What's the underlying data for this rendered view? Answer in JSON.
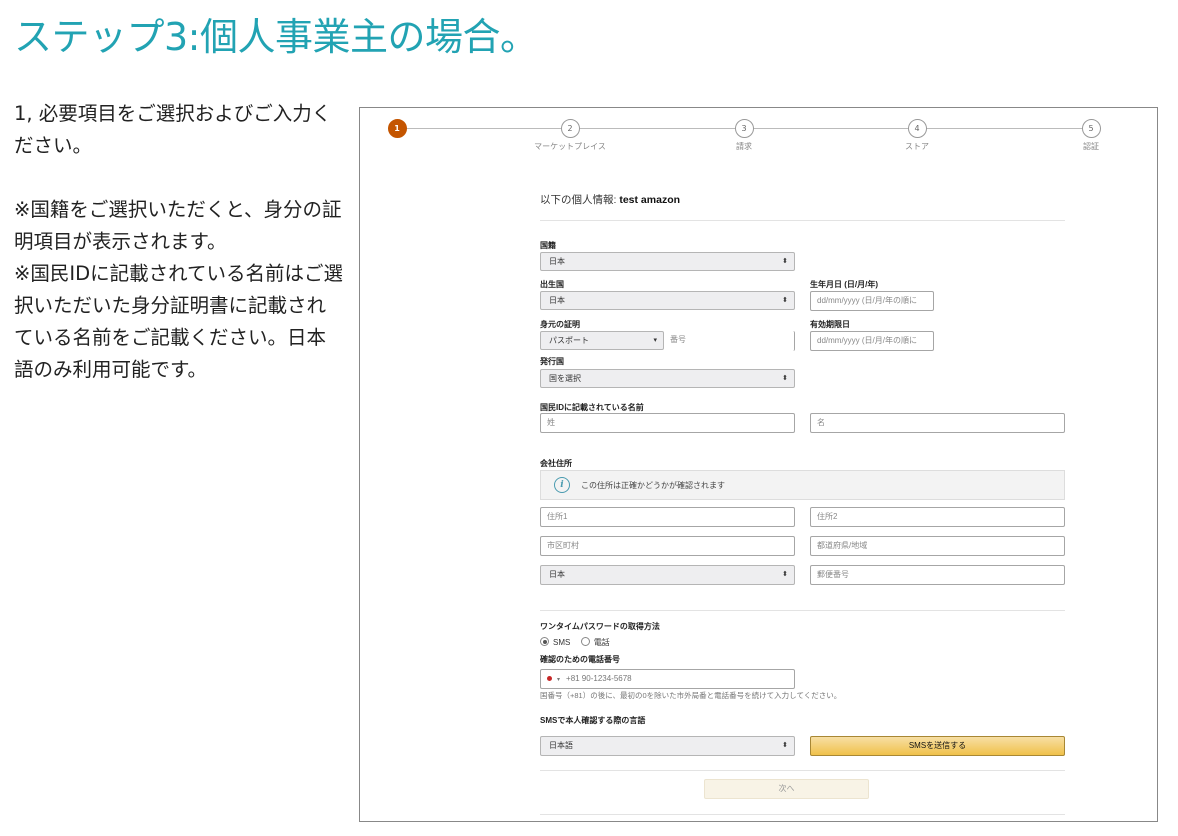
{
  "page_title": "ステップ3:個人事業主の場合。",
  "instructions": {
    "line1": "1, 必要項目をご選択およびご入力ください。",
    "note1": "※国籍をご選択いただくと、身分の証明項目が表示されます。",
    "note2": "※国民IDに記載されている名前はご選択いただいた身分証明書に記載されている名前をご記載ください。日本語のみ利用可能です。"
  },
  "stepper": [
    {
      "number": "1",
      "label": "",
      "active": true
    },
    {
      "number": "2",
      "label": "マーケットプレイス",
      "active": false
    },
    {
      "number": "3",
      "label": "請求",
      "active": false
    },
    {
      "number": "4",
      "label": "ストア",
      "active": false
    },
    {
      "number": "5",
      "label": "認証",
      "active": false
    }
  ],
  "form": {
    "header_prefix": "以下の個人情報: ",
    "header_name": "test amazon",
    "nationality": {
      "label": "国籍",
      "value": "日本"
    },
    "birth_country": {
      "label": "出生国",
      "value": "日本"
    },
    "birth_date": {
      "label": "生年月日 (日/月/年)",
      "placeholder": "dd/mm/yyyy (日/月/年の順に"
    },
    "id_proof": {
      "label": "身元の証明",
      "value": "パスポート",
      "number_placeholder": "番号"
    },
    "expiry": {
      "label": "有効期限日",
      "placeholder": "dd/mm/yyyy (日/月/年の順に"
    },
    "issuing_country": {
      "label": "発行国",
      "value": "国を選択"
    },
    "name_on_id": {
      "label": "国民IDに記載されている名前",
      "last_placeholder": "姓",
      "first_placeholder": "名"
    },
    "company_address": {
      "label": "会社住所",
      "info": "この住所は正確かどうかが確認されます",
      "address1_placeholder": "住所1",
      "address2_placeholder": "住所2",
      "city_placeholder": "市区町村",
      "prefecture_placeholder": "都道府県/地域",
      "country_value": "日本",
      "postal_placeholder": "郵便番号"
    },
    "otp": {
      "label": "ワンタイムパスワードの取得方法",
      "option_sms": "SMS",
      "option_phone": "電話",
      "selected": "SMS"
    },
    "phone": {
      "label": "確認のための電話番号",
      "placeholder": "+81 90-1234-5678",
      "help": "国番号（+81）の後に、最初の0を除いた市外局番と電話番号を続けて入力してください。"
    },
    "sms_language": {
      "label": "SMSで本人確認する際の言語",
      "value": "日本語"
    },
    "send_sms_button": "SMSを送信する",
    "next_button": "次へ"
  },
  "colors": {
    "title": "#22a3b3",
    "active_step": "#c45500",
    "button": "#f0c14b"
  }
}
